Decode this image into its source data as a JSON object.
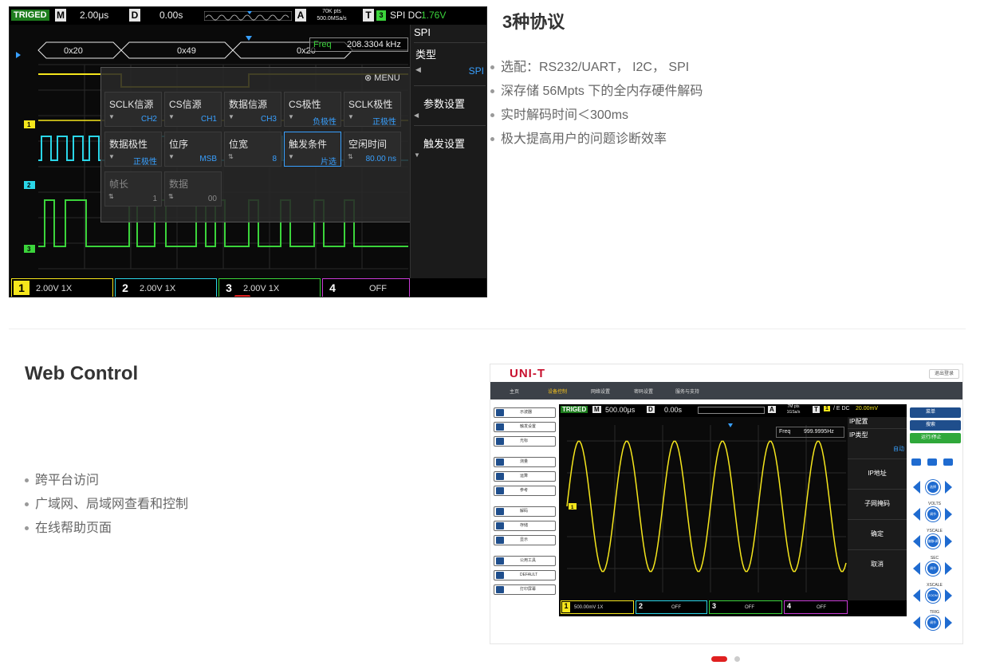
{
  "section1": {
    "title": "3种协议",
    "bullets": [
      "选配：RS232/UART， I2C， SPI",
      "深存储 56Mpts 下的全内存硬件解码",
      "实时解码时间＜300ms",
      "极大提高用户的问题诊断效率"
    ]
  },
  "section2": {
    "title": "Web Control",
    "bullets": [
      "跨平台访问",
      "广域网、局域网查看和控制",
      "在线帮助页面"
    ]
  },
  "scope1": {
    "status": "TRIGED",
    "m_label": "M",
    "timebase": "2.00μs",
    "d_label": "D",
    "delay": "0.00s",
    "a_label": "A",
    "pts": "70K pts",
    "rate": "500.0MSa/s",
    "t_label": "T",
    "trig_ch": "3",
    "trig_type": "SPI DC",
    "trig_level": "1.76V",
    "decode_values": [
      "0x20",
      "0x49",
      "0x20"
    ],
    "freq_label": "Freq",
    "freq_value": "208.3304 kHz",
    "menu_label": "MENU",
    "right_menu": {
      "title": "SPI",
      "type_label": "类型",
      "type_value": "SPI",
      "params": "参数设置",
      "trigger": "触发设置"
    },
    "cells": [
      {
        "label": "SCLK信源",
        "value": "CH2"
      },
      {
        "label": "CS信源",
        "value": "CH1"
      },
      {
        "label": "数据信源",
        "value": "CH3"
      },
      {
        "label": "CS极性",
        "value": "负极性"
      },
      {
        "label": "SCLK极性",
        "value": "正极性"
      },
      {
        "label": "数据极性",
        "value": "正极性"
      },
      {
        "label": "位序",
        "value": "MSB"
      },
      {
        "label": "位宽",
        "value": "8"
      },
      {
        "label": "触发条件",
        "value": "片选"
      },
      {
        "label": "空闲时间",
        "value": "80.00 ns"
      },
      {
        "label": "帧长",
        "value": "1"
      },
      {
        "label": "数据",
        "value": "00"
      }
    ],
    "channels": [
      {
        "num": "1",
        "setting": "2.00V  1X",
        "color": "#f5e61c"
      },
      {
        "num": "2",
        "setting": "2.00V  1X",
        "color": "#2ad6e8"
      },
      {
        "num": "3",
        "setting": "2.00V  1X",
        "color": "#3bd43b"
      },
      {
        "num": "4",
        "setting": "OFF",
        "color": "#c93bd6"
      }
    ]
  },
  "web": {
    "logo": "UNI-T",
    "login": "退出登录",
    "nav": [
      "主页",
      "设备控制",
      "网络设置",
      "密码设置",
      "服务与支持"
    ],
    "left_buttons": [
      "示波器",
      "触发设置",
      "光标",
      "测量",
      "运算",
      "参考",
      "解码",
      "存储",
      "显示",
      "公用工具",
      "DEFAULT",
      "打印屏幕"
    ],
    "scope": {
      "status": "TRIGED",
      "m_label": "M",
      "timebase": "500.00μs",
      "d_label": "D",
      "delay": "0.00s",
      "a_label": "A",
      "pts": "7M pts",
      "rate": "1GSa/s",
      "t_label": "T",
      "trig_ch": "1",
      "trig_type": "/ E DC",
      "trig_level": "20.00mV",
      "freq_label": "Freq",
      "freq_value": "999.9995Hz",
      "menu_title": "IP配置",
      "ip_type": "IP类型",
      "ip_type_value": "自动",
      "ip_addr": "IP地址",
      "subnet": "子网掩码",
      "ok": "确定",
      "cancel": "取消",
      "channels": [
        {
          "num": "1",
          "setting": "500.00mV  1X",
          "color": "#f5e61c"
        },
        {
          "num": "2",
          "setting": "OFF",
          "color": "#2ad6e8"
        },
        {
          "num": "3",
          "setting": "OFF",
          "color": "#3bd43b"
        },
        {
          "num": "4",
          "setting": "OFF",
          "color": "#c93bd6"
        }
      ]
    },
    "right_panel": {
      "menu": "菜单",
      "search": "搜索",
      "run_stop": "运行/停止",
      "knob_labels": [
        "选择",
        "VOLTS",
        "调节",
        "YSCALE",
        "偏移/调速",
        "SEC",
        "调节",
        "XSCALE",
        "ZOOM",
        "TRIG",
        "调节"
      ]
    }
  }
}
